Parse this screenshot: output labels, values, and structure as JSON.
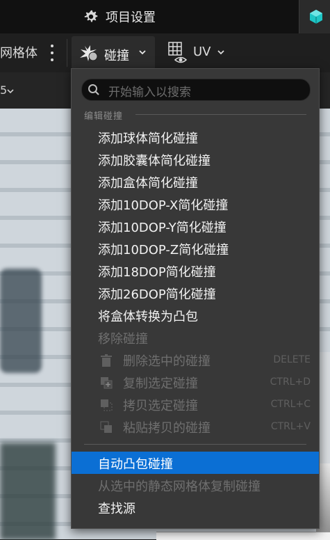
{
  "tabs": {
    "project_settings": "项目设置"
  },
  "toolbar": {
    "mesh_label": "网格体",
    "collision_label": "碰撞",
    "uv_label": "UV"
  },
  "subbar": {
    "fragment": "5"
  },
  "menu": {
    "search_placeholder": "开始输入以搜索",
    "section_label": "编辑碰撞",
    "items": [
      {
        "label": "添加球体简化碰撞"
      },
      {
        "label": "添加胶囊体简化碰撞"
      },
      {
        "label": "添加盒体简化碰撞"
      },
      {
        "label": "添加10DOP-X简化碰撞"
      },
      {
        "label": "添加10DOP-Y简化碰撞"
      },
      {
        "label": "添加10DOP-Z简化碰撞"
      },
      {
        "label": "添加18DOP简化碰撞"
      },
      {
        "label": "添加26DOP简化碰撞"
      },
      {
        "label": "将盒体转换为凸包"
      },
      {
        "label": "移除碰撞"
      }
    ],
    "sub_items": [
      {
        "label": "删除选中的碰撞",
        "shortcut": "DELETE",
        "icon": "trash-icon"
      },
      {
        "label": "复制选定碰撞",
        "shortcut": "CTRL+D",
        "icon": "duplicate-icon"
      },
      {
        "label": "拷贝选定碰撞",
        "shortcut": "CTRL+C",
        "icon": "copy-icon"
      },
      {
        "label": "粘贴拷贝的碰撞",
        "shortcut": "CTRL+V",
        "icon": "paste-icon"
      }
    ],
    "bottom_items": [
      {
        "label": "自动凸包碰撞"
      },
      {
        "label": "从选中的静态网格体复制碰撞"
      },
      {
        "label": "查找源"
      }
    ]
  },
  "colors": {
    "highlight": "#0b6fd4",
    "menu_bg": "#383838",
    "disabled_text": "#6f6f6f"
  }
}
